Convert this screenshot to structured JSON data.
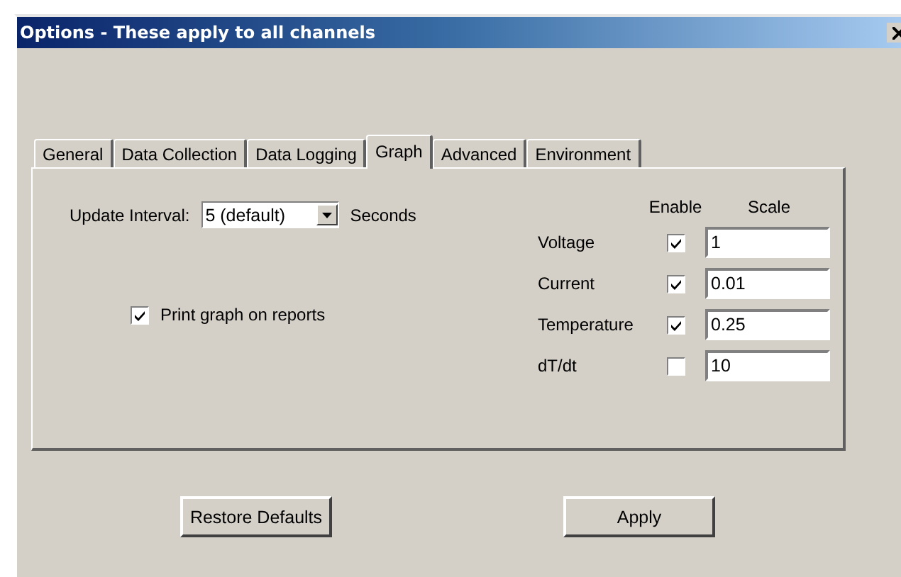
{
  "window": {
    "title": "Options - These apply to all channels"
  },
  "tabs": [
    {
      "label": "General",
      "selected": false
    },
    {
      "label": "Data Collection",
      "selected": false
    },
    {
      "label": "Data Logging",
      "selected": false
    },
    {
      "label": "Graph",
      "selected": true
    },
    {
      "label": "Advanced",
      "selected": false
    },
    {
      "label": "Environment",
      "selected": false
    }
  ],
  "update_interval": {
    "label": "Update Interval:",
    "value": "5 (default)",
    "unit": "Seconds"
  },
  "print_graph": {
    "label": "Print graph on reports",
    "checked": true
  },
  "channels_header": {
    "enable": "Enable",
    "scale": "Scale"
  },
  "channels": [
    {
      "name": "Voltage",
      "enabled": true,
      "scale": "1"
    },
    {
      "name": "Current",
      "enabled": true,
      "scale": "0.01"
    },
    {
      "name": "Temperature",
      "enabled": true,
      "scale": "0.25"
    },
    {
      "name": "dT/dt",
      "enabled": false,
      "scale": "10"
    }
  ],
  "buttons": [
    "Restore Defaults",
    "Apply"
  ]
}
